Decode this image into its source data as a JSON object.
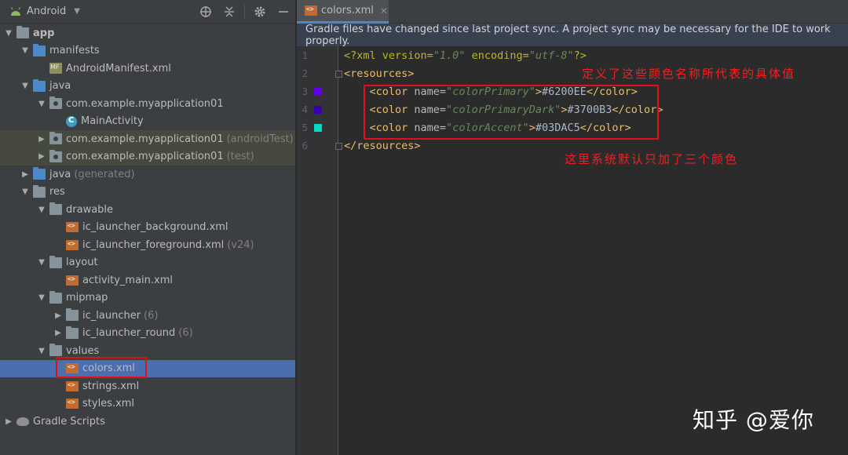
{
  "panel": {
    "view_title": "Android",
    "toolbar_icons": [
      "crosshair-icon",
      "collapse-icon",
      "gear-icon",
      "minimize-icon"
    ]
  },
  "tree": [
    {
      "label": "app",
      "bold": true,
      "level": 0,
      "expanded": true,
      "icon": "module-folder"
    },
    {
      "label": "manifests",
      "level": 1,
      "expanded": true,
      "icon": "folder-blue"
    },
    {
      "label": "AndroidManifest.xml",
      "level": 2,
      "icon": "manifest-file"
    },
    {
      "label": "java",
      "level": 1,
      "expanded": true,
      "icon": "folder-blue"
    },
    {
      "label": "com.example.myapplication01",
      "level": 2,
      "expanded": true,
      "icon": "package"
    },
    {
      "label": "MainActivity",
      "level": 3,
      "icon": "class"
    },
    {
      "label": "com.example.myapplication01",
      "hint": "(androidTest)",
      "level": 2,
      "expanded": false,
      "icon": "package",
      "highlight": true
    },
    {
      "label": "com.example.myapplication01",
      "hint": "(test)",
      "level": 2,
      "expanded": false,
      "icon": "package",
      "highlight": true
    },
    {
      "label": "java",
      "hint": "(generated)",
      "level": 1,
      "expanded": false,
      "icon": "folder-gen"
    },
    {
      "label": "res",
      "level": 1,
      "expanded": true,
      "icon": "folder-res"
    },
    {
      "label": "drawable",
      "level": 2,
      "expanded": true,
      "icon": "folder"
    },
    {
      "label": "ic_launcher_background.xml",
      "level": 3,
      "icon": "xml"
    },
    {
      "label": "ic_launcher_foreground.xml",
      "hint": "(v24)",
      "level": 3,
      "icon": "xml"
    },
    {
      "label": "layout",
      "level": 2,
      "expanded": true,
      "icon": "folder"
    },
    {
      "label": "activity_main.xml",
      "level": 3,
      "icon": "xml"
    },
    {
      "label": "mipmap",
      "level": 2,
      "expanded": true,
      "icon": "folder"
    },
    {
      "label": "ic_launcher",
      "hint": "(6)",
      "level": 3,
      "expanded": false,
      "icon": "folder"
    },
    {
      "label": "ic_launcher_round",
      "hint": "(6)",
      "level": 3,
      "expanded": false,
      "icon": "folder"
    },
    {
      "label": "values",
      "level": 2,
      "expanded": true,
      "icon": "folder"
    },
    {
      "label": "colors.xml",
      "level": 3,
      "icon": "xml",
      "selected": true
    },
    {
      "label": "strings.xml",
      "level": 3,
      "icon": "xml"
    },
    {
      "label": "styles.xml",
      "level": 3,
      "icon": "xml"
    },
    {
      "label": "Gradle Scripts",
      "level": 0,
      "expanded": false,
      "icon": "gradle"
    }
  ],
  "editor": {
    "tab_label": "colors.xml",
    "banner": "Gradle files have changed since last project sync. A project sync may be necessary for the IDE to work properly.",
    "lines": [
      {
        "num": "1",
        "parts": [
          [
            "t-decl",
            "<?xml version="
          ],
          [
            "t-val",
            "\"1.0\""
          ],
          [
            "t-decl",
            " encoding="
          ],
          [
            "t-val",
            "\"utf-8\""
          ],
          [
            "t-decl",
            "?>"
          ]
        ]
      },
      {
        "num": "2",
        "parts": [
          [
            "t-tag",
            "<resources>"
          ]
        ]
      },
      {
        "num": "3",
        "swatch": "#6200EE",
        "parts": [
          [
            "t-text",
            "    "
          ],
          [
            "t-tag",
            "<color "
          ],
          [
            "t-attr",
            "name="
          ],
          [
            "t-val",
            "\"colorPrimary\""
          ],
          [
            "t-tag",
            ">"
          ],
          [
            "t-text",
            "#6200EE"
          ],
          [
            "t-tag",
            "</color>"
          ]
        ]
      },
      {
        "num": "4",
        "swatch": "#3700B3",
        "parts": [
          [
            "t-text",
            "    "
          ],
          [
            "t-tag",
            "<color "
          ],
          [
            "t-attr",
            "name="
          ],
          [
            "t-val",
            "\"colorPrimaryDark\""
          ],
          [
            "t-tag",
            ">"
          ],
          [
            "t-text",
            "#3700B3"
          ],
          [
            "t-tag",
            "</color>"
          ]
        ]
      },
      {
        "num": "5",
        "swatch": "#03DAC5",
        "parts": [
          [
            "t-text",
            "    "
          ],
          [
            "t-tag",
            "<color "
          ],
          [
            "t-attr",
            "name="
          ],
          [
            "t-val",
            "\"colorAccent\""
          ],
          [
            "t-tag",
            ">"
          ],
          [
            "t-text",
            "#03DAC5"
          ],
          [
            "t-tag",
            "</color>"
          ]
        ]
      },
      {
        "num": "6",
        "parts": [
          [
            "t-tag",
            "</resources>"
          ]
        ]
      }
    ]
  },
  "annotations": {
    "top": "定义了这些颜色名称所代表的具体值",
    "bottom": "这里系统默认只加了三个颜色"
  },
  "watermark": "知乎 @爱你",
  "colors": {
    "selection": "#4b6eaf",
    "annotation_red": "#e0101a",
    "banner_bg": "#374150"
  }
}
